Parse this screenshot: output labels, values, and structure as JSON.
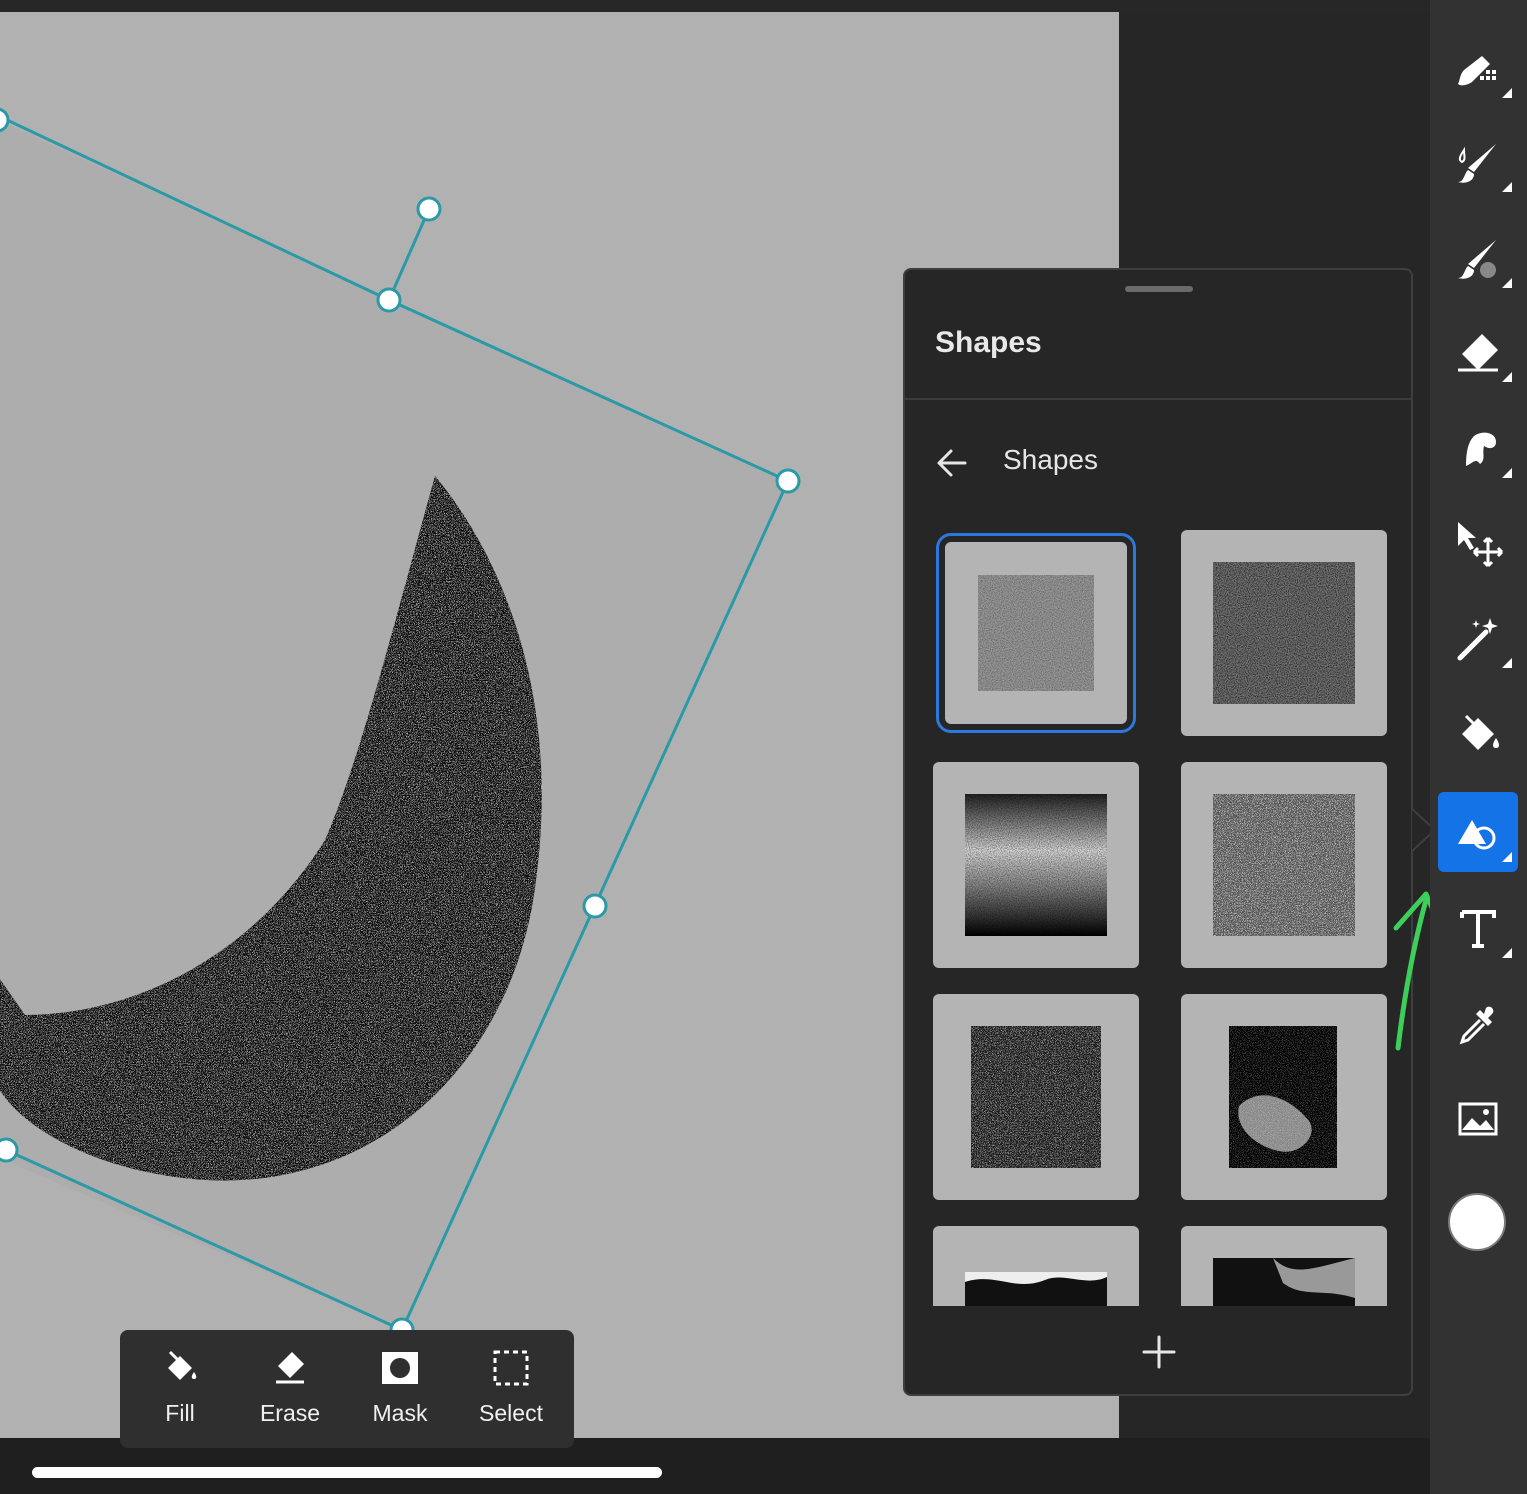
{
  "panel": {
    "title": "Shapes",
    "breadcrumb_label": "Shapes",
    "tiles": [
      {
        "name": "shape-tile-1",
        "selected": true
      },
      {
        "name": "shape-tile-2",
        "selected": false
      },
      {
        "name": "shape-tile-3",
        "selected": false
      },
      {
        "name": "shape-tile-4",
        "selected": false
      },
      {
        "name": "shape-tile-5",
        "selected": false
      },
      {
        "name": "shape-tile-6",
        "selected": false
      },
      {
        "name": "shape-tile-7",
        "selected": false
      },
      {
        "name": "shape-tile-8",
        "selected": false
      }
    ]
  },
  "toolbar": {
    "tools": [
      {
        "name": "pixel-brush-tool",
        "icon": "pixel-brush-icon"
      },
      {
        "name": "live-brush-tool",
        "icon": "live-brush-icon"
      },
      {
        "name": "vector-brush-tool",
        "icon": "vector-brush-icon"
      },
      {
        "name": "eraser-tool",
        "icon": "eraser-icon"
      },
      {
        "name": "smudge-tool",
        "icon": "smudge-icon"
      },
      {
        "name": "transform-tool",
        "icon": "move-icon"
      },
      {
        "name": "magic-wand-tool",
        "icon": "magic-wand-icon"
      },
      {
        "name": "fill-tool",
        "icon": "paint-bucket-icon"
      },
      {
        "name": "shapes-tool",
        "icon": "shapes-icon",
        "active": true
      },
      {
        "name": "text-tool",
        "icon": "text-icon"
      },
      {
        "name": "eyedropper-tool",
        "icon": "eyedropper-icon"
      },
      {
        "name": "image-tool",
        "icon": "image-icon"
      }
    ],
    "current_color": "#ffffff"
  },
  "action_bar": {
    "fill_label": "Fill",
    "erase_label": "Erase",
    "mask_label": "Mask",
    "select_label": "Select"
  },
  "colors": {
    "accent": "#1473e6",
    "selection_handles": "#2a9aa6",
    "annotation_arrow": "#3ccf5a"
  }
}
